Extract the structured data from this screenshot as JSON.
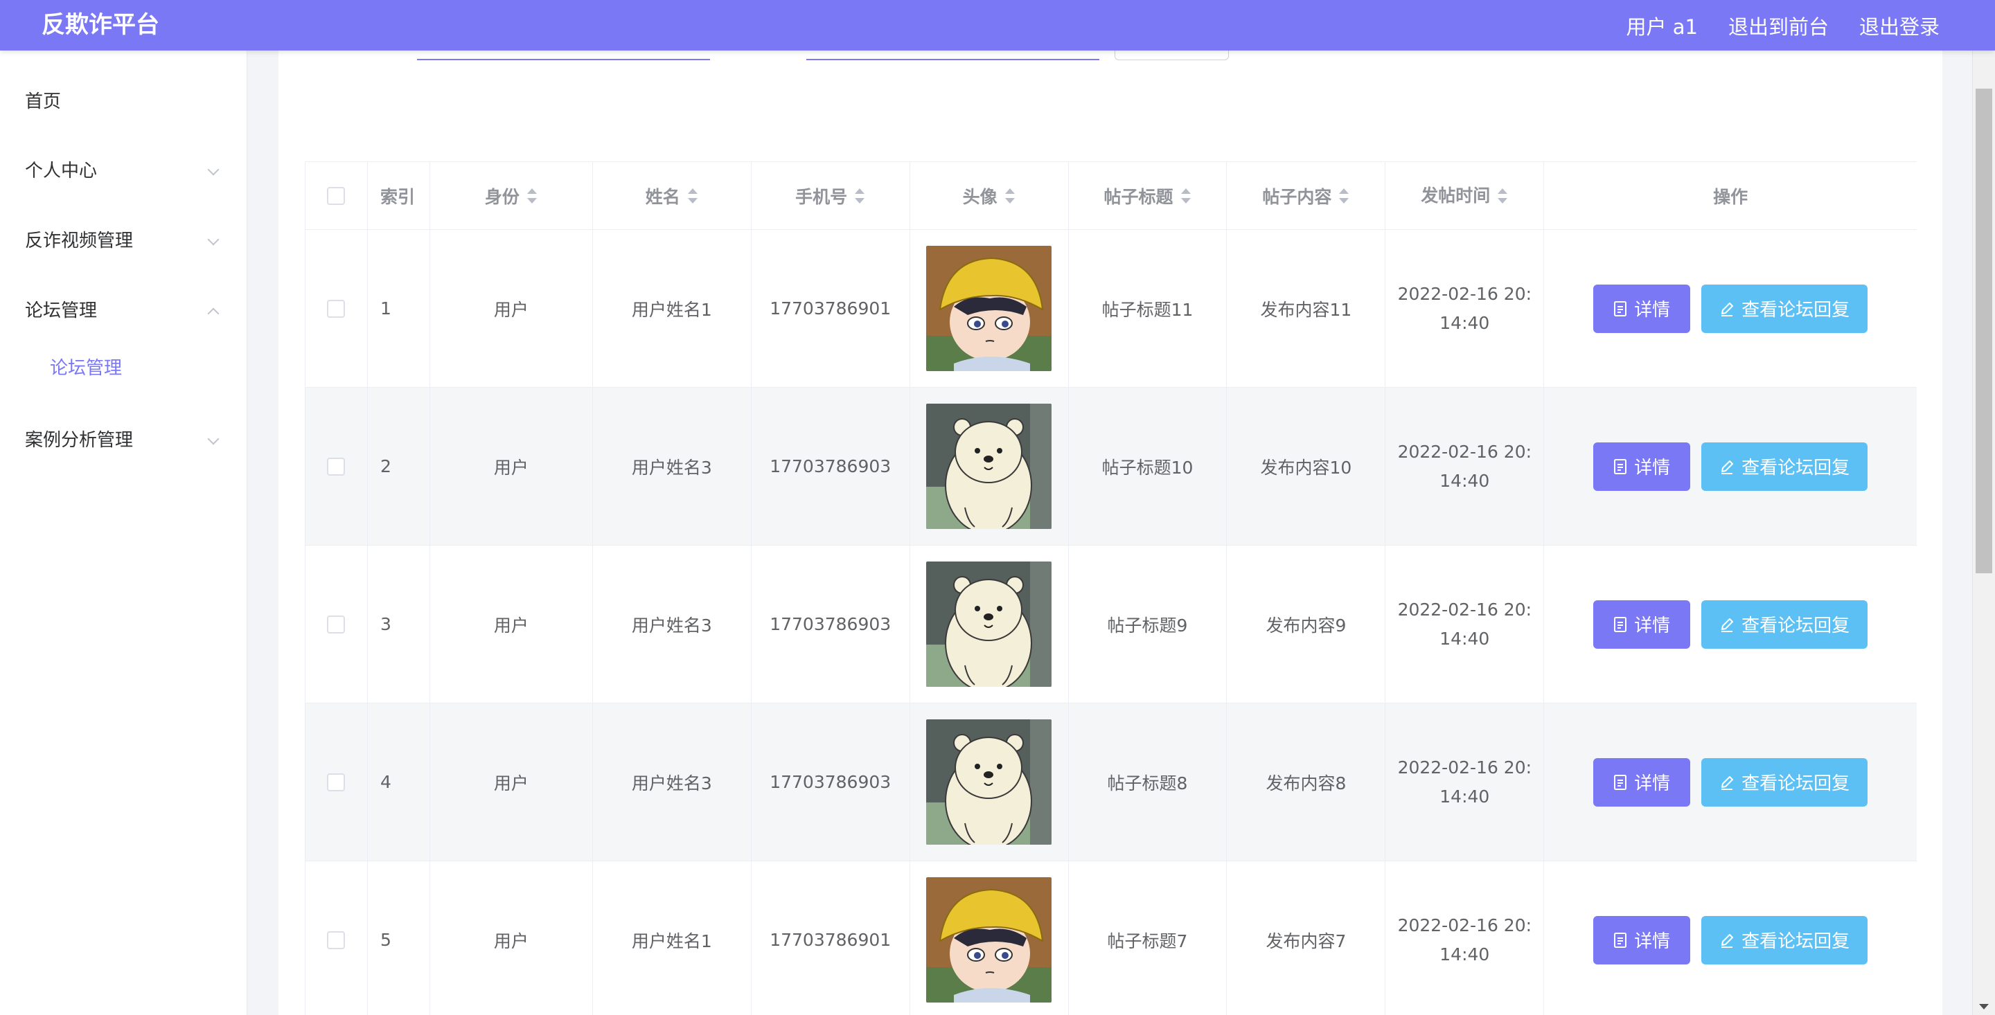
{
  "app": {
    "brand": "反欺诈平台"
  },
  "header": {
    "user_label": "用户 a1",
    "front_label": "退出到前台",
    "logout_label": "退出登录"
  },
  "sidebar": {
    "items": [
      {
        "label": "首页",
        "expandable": false
      },
      {
        "label": "个人中心",
        "expandable": true,
        "expanded": false
      },
      {
        "label": "反诈视频管理",
        "expandable": true,
        "expanded": false
      },
      {
        "label": "论坛管理",
        "expandable": true,
        "expanded": true,
        "children": [
          {
            "label": "论坛管理",
            "active": true
          }
        ]
      },
      {
        "label": "案例分析管理",
        "expandable": true,
        "expanded": false
      }
    ]
  },
  "table": {
    "columns": {
      "index": "索引",
      "role": "身份",
      "name": "姓名",
      "phone": "手机号",
      "avatar": "头像",
      "title": "帖子标题",
      "content": "帖子内容",
      "time": "发帖时间",
      "ops": "操作"
    },
    "detail_label": "详情",
    "reply_label": "查看论坛回复",
    "rows": [
      {
        "index": "1",
        "role": "用户",
        "name": "用户姓名1",
        "phone": "17703786901",
        "avatar": "boy-yellow-hat",
        "title": "帖子标题11",
        "content": "发布内容11",
        "time_line1": "2022-02-16 20:",
        "time_line2": "14:40"
      },
      {
        "index": "2",
        "role": "用户",
        "name": "用户姓名3",
        "phone": "17703786903",
        "avatar": "white-bear",
        "title": "帖子标题10",
        "content": "发布内容10",
        "time_line1": "2022-02-16 20:",
        "time_line2": "14:40"
      },
      {
        "index": "3",
        "role": "用户",
        "name": "用户姓名3",
        "phone": "17703786903",
        "avatar": "white-bear",
        "title": "帖子标题9",
        "content": "发布内容9",
        "time_line1": "2022-02-16 20:",
        "time_line2": "14:40"
      },
      {
        "index": "4",
        "role": "用户",
        "name": "用户姓名3",
        "phone": "17703786903",
        "avatar": "white-bear",
        "title": "帖子标题8",
        "content": "发布内容8",
        "time_line1": "2022-02-16 20:",
        "time_line2": "14:40"
      },
      {
        "index": "5",
        "role": "用户",
        "name": "用户姓名1",
        "phone": "17703786901",
        "avatar": "boy-yellow-hat",
        "title": "帖子标题7",
        "content": "发布内容7",
        "time_line1": "2022-02-16 20:",
        "time_line2": "14:40"
      }
    ]
  },
  "colors": {
    "primary": "#7b78f5",
    "info": "#5cc0f5"
  }
}
